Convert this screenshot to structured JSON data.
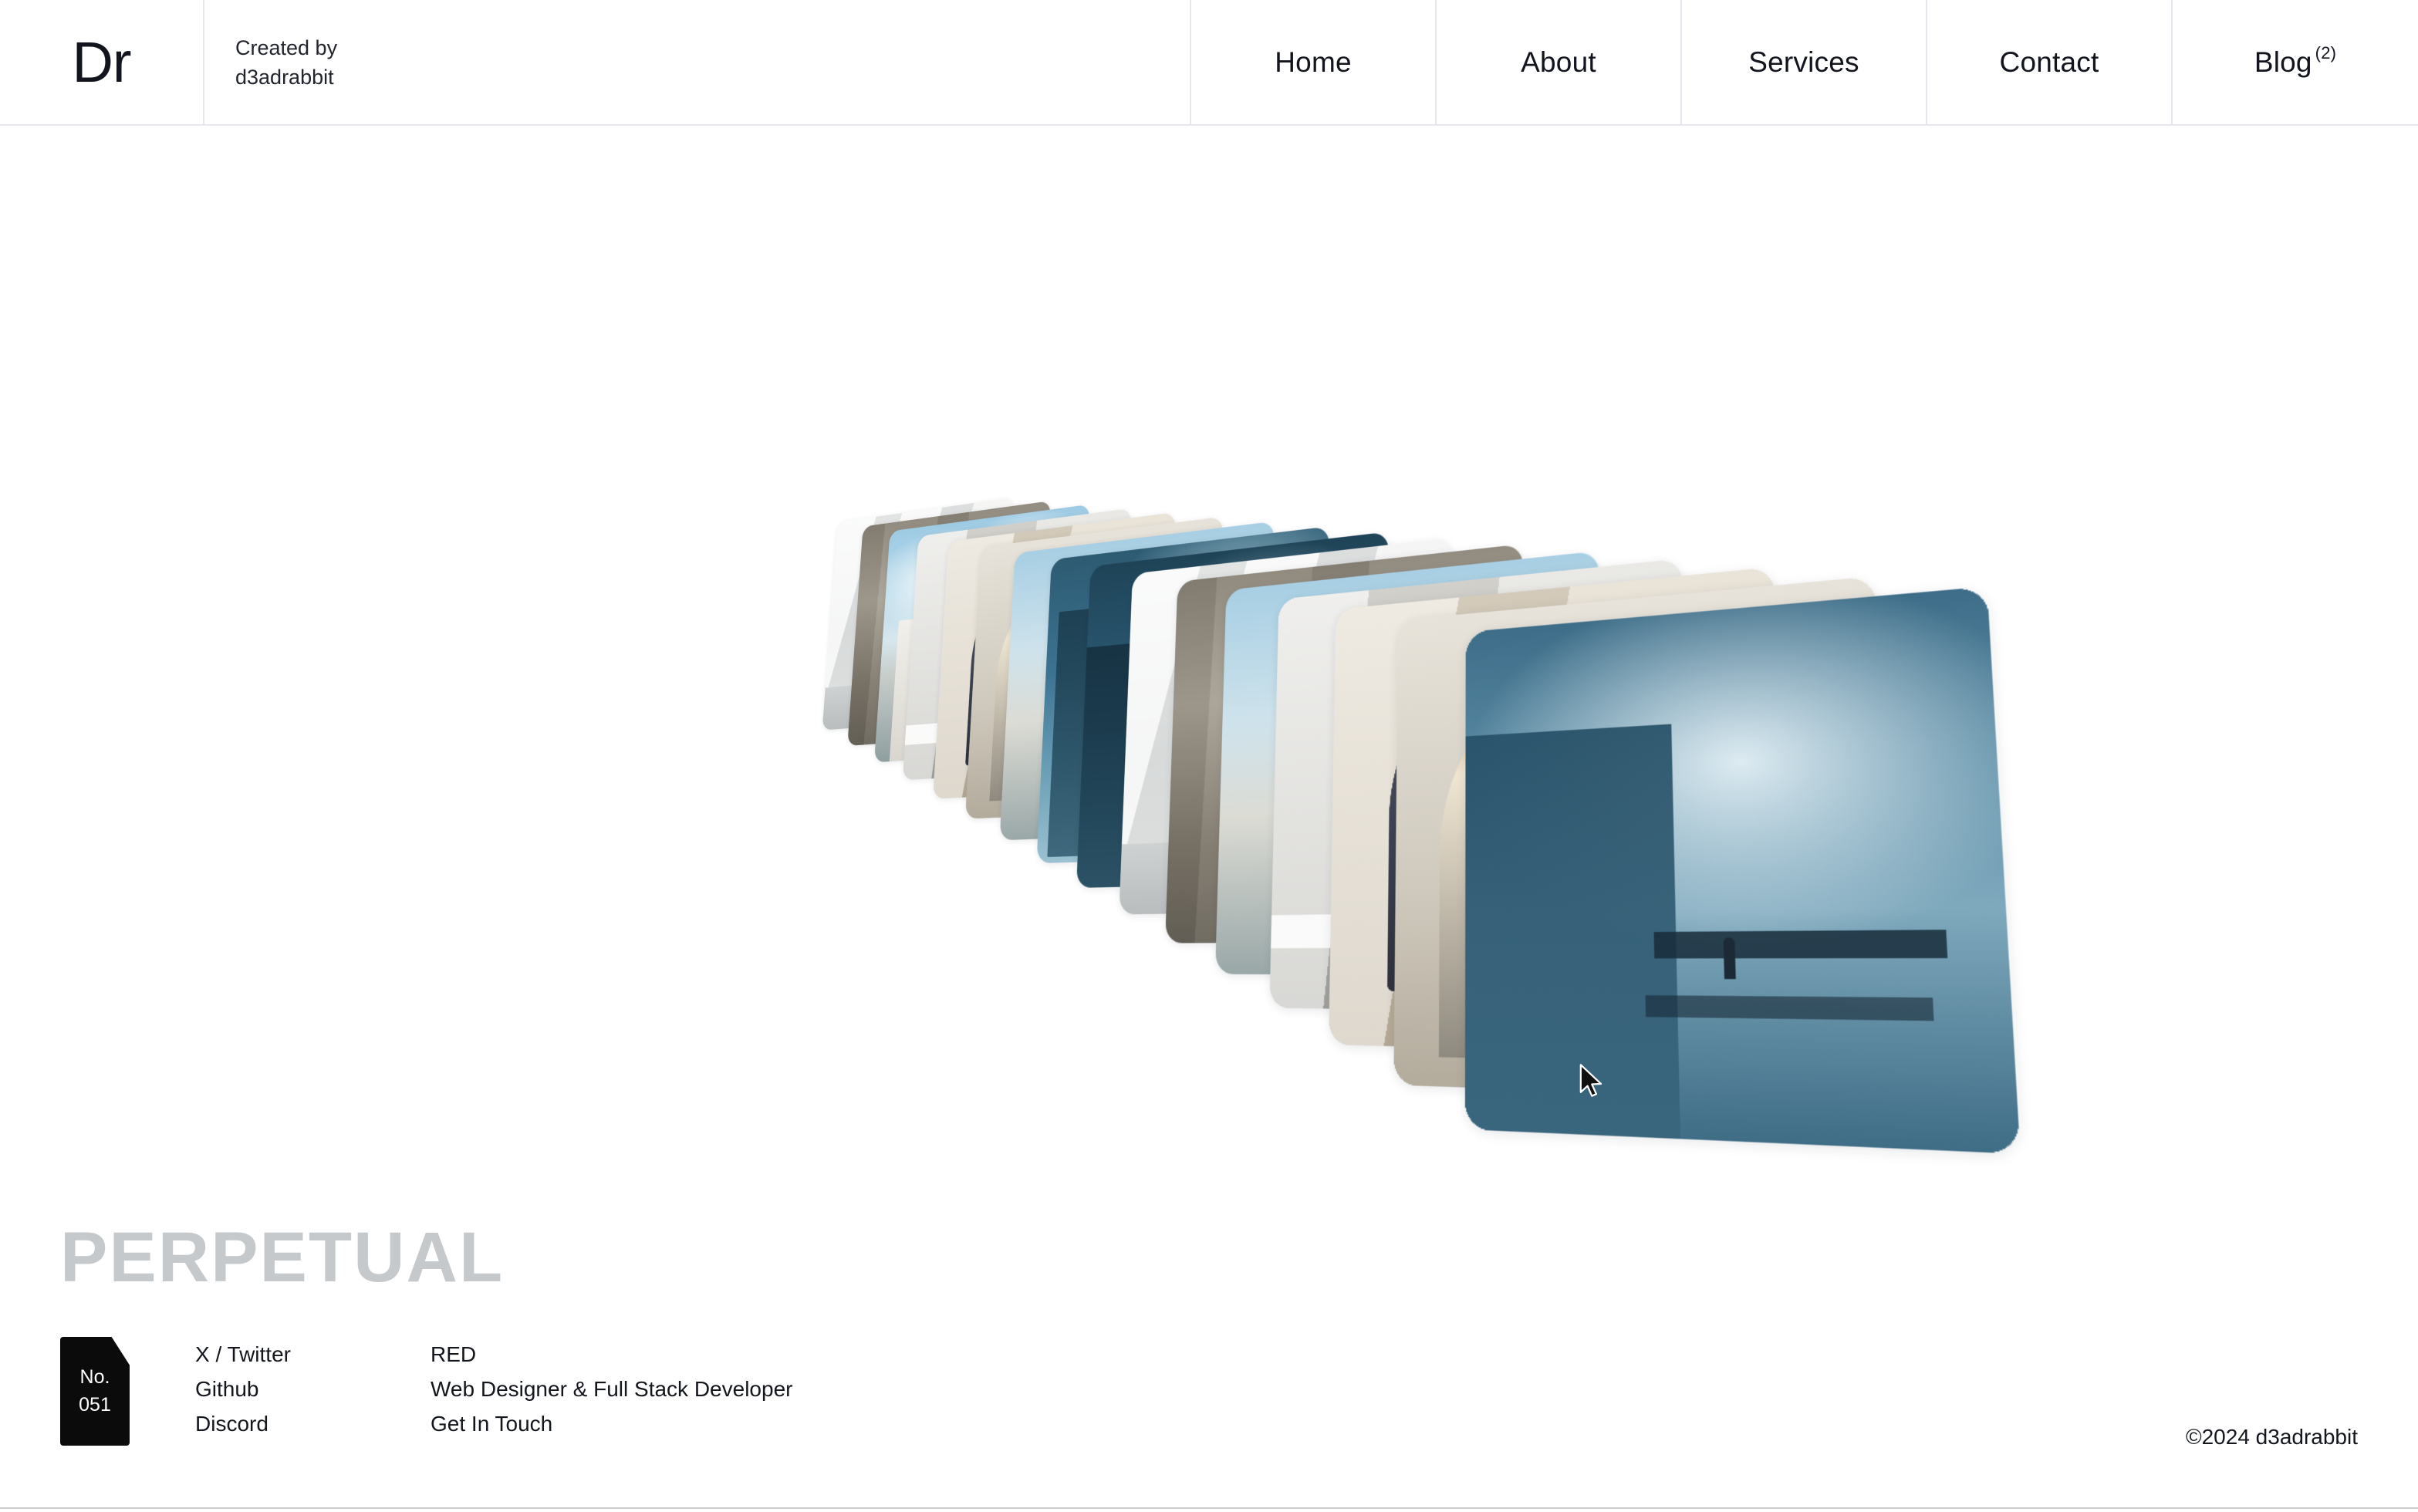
{
  "header": {
    "logo": "Dr",
    "credit_line1": "Created by",
    "credit_line2": "d3adrabbit",
    "nav": [
      {
        "label": "Home",
        "sup": ""
      },
      {
        "label": "About",
        "sup": ""
      },
      {
        "label": "Services",
        "sup": ""
      },
      {
        "label": "Contact",
        "sup": ""
      },
      {
        "label": "Blog",
        "sup": "(2)"
      }
    ]
  },
  "gallery": {
    "card_count": 16,
    "cards": [
      {
        "art": "art-marble",
        "alt": "marble wall interior"
      },
      {
        "art": "art-concrete",
        "alt": "concrete beam structure"
      },
      {
        "art": "art-sky",
        "alt": "sky over white wall"
      },
      {
        "art": "art-wall",
        "alt": "pale concrete wall"
      },
      {
        "art": "art-sand",
        "alt": "sand arch with dark vault"
      },
      {
        "art": "art-arch",
        "alt": "golden arch corridor"
      },
      {
        "art": "art-circle",
        "alt": "white circle and clouds"
      },
      {
        "art": "art-teal",
        "alt": "teal facade"
      },
      {
        "art": "art-navy",
        "alt": "navy monolith"
      },
      {
        "art": "art-marble",
        "alt": "marble column"
      },
      {
        "art": "art-concrete",
        "alt": "concrete overhang"
      },
      {
        "art": "art-circle",
        "alt": "circular opening sky"
      },
      {
        "art": "art-wall",
        "alt": "light stone wall"
      },
      {
        "art": "art-sand",
        "alt": "beige interior arch"
      },
      {
        "art": "art-arch",
        "alt": "curved stone arch"
      },
      {
        "art": "art-mist",
        "alt": "blue mist walkway with figure"
      }
    ]
  },
  "footer": {
    "title": "PERPETUAL",
    "badge_label": "No.",
    "badge_number": "051",
    "links": [
      "X / Twitter",
      "Github",
      "Discord"
    ],
    "info": [
      "RED",
      "Web Designer & Full Stack Developer",
      "Get In Touch"
    ],
    "copyright": "©2024 d3adrabbit"
  },
  "colors": {
    "text": "#13161d",
    "border": "#e7e8ef",
    "title_gray": "#c5c9cb",
    "badge_bg": "#0b0b0b",
    "background": "#ffffff"
  }
}
